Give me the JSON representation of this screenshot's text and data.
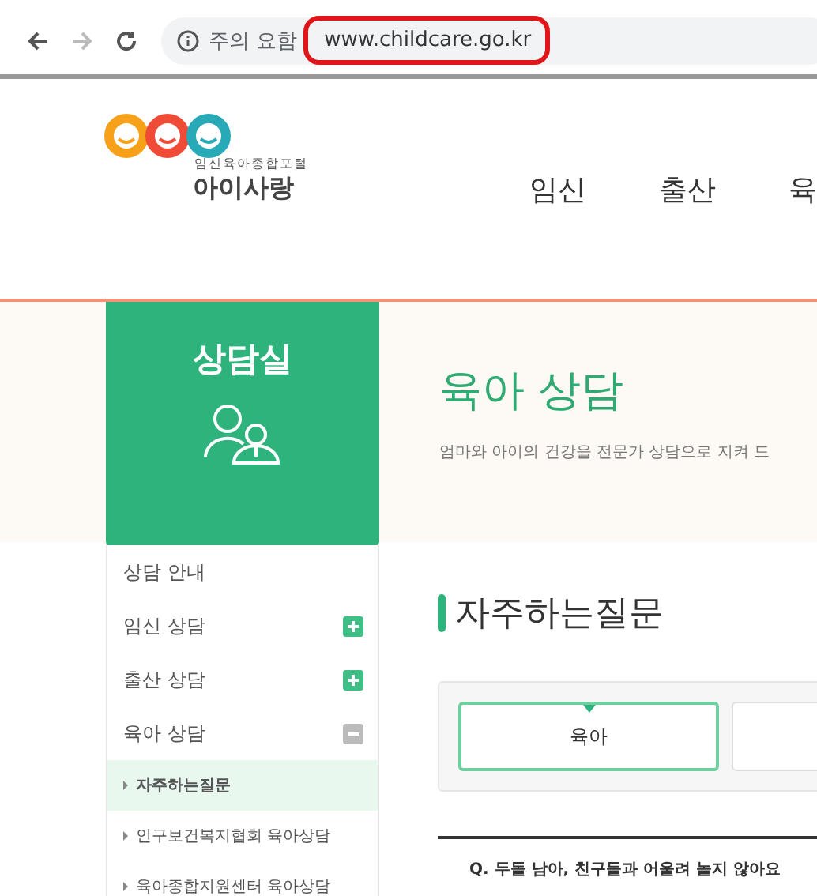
{
  "browser": {
    "security_label": "주의 요함",
    "url": "www.childcare.go.kr",
    "url_highlighted": true
  },
  "logo": {
    "tagline": "임신육아종합포털",
    "name": "아이사랑"
  },
  "nav": [
    {
      "label": "임신"
    },
    {
      "label": "출산"
    },
    {
      "label": "육"
    }
  ],
  "hero": {
    "panel_title": "상담실",
    "title": "육아 상담",
    "subtitle": "엄마와 아이의 건강을 전문가 상담으로 지켜 드"
  },
  "sidebar": {
    "items": [
      {
        "label": "상담 안내",
        "kind": "plain"
      },
      {
        "label": "임신 상담",
        "kind": "toggle",
        "expanded": false
      },
      {
        "label": "출산 상담",
        "kind": "toggle",
        "expanded": false
      },
      {
        "label": "육아 상담",
        "kind": "toggle",
        "expanded": true,
        "children": [
          {
            "label": "자주하는질문",
            "selected": true
          },
          {
            "label": "인구보건복지협회 육아상담",
            "selected": false
          },
          {
            "label": "육아종합지원센터 육아상담",
            "selected": false
          }
        ]
      }
    ]
  },
  "section_title": "자주하는질문",
  "tabs": [
    {
      "label": "육아",
      "selected": true
    },
    {
      "selected": false
    }
  ],
  "question": "Q. 두돌 남아, 친구들과 어울려 놀지 않아요"
}
